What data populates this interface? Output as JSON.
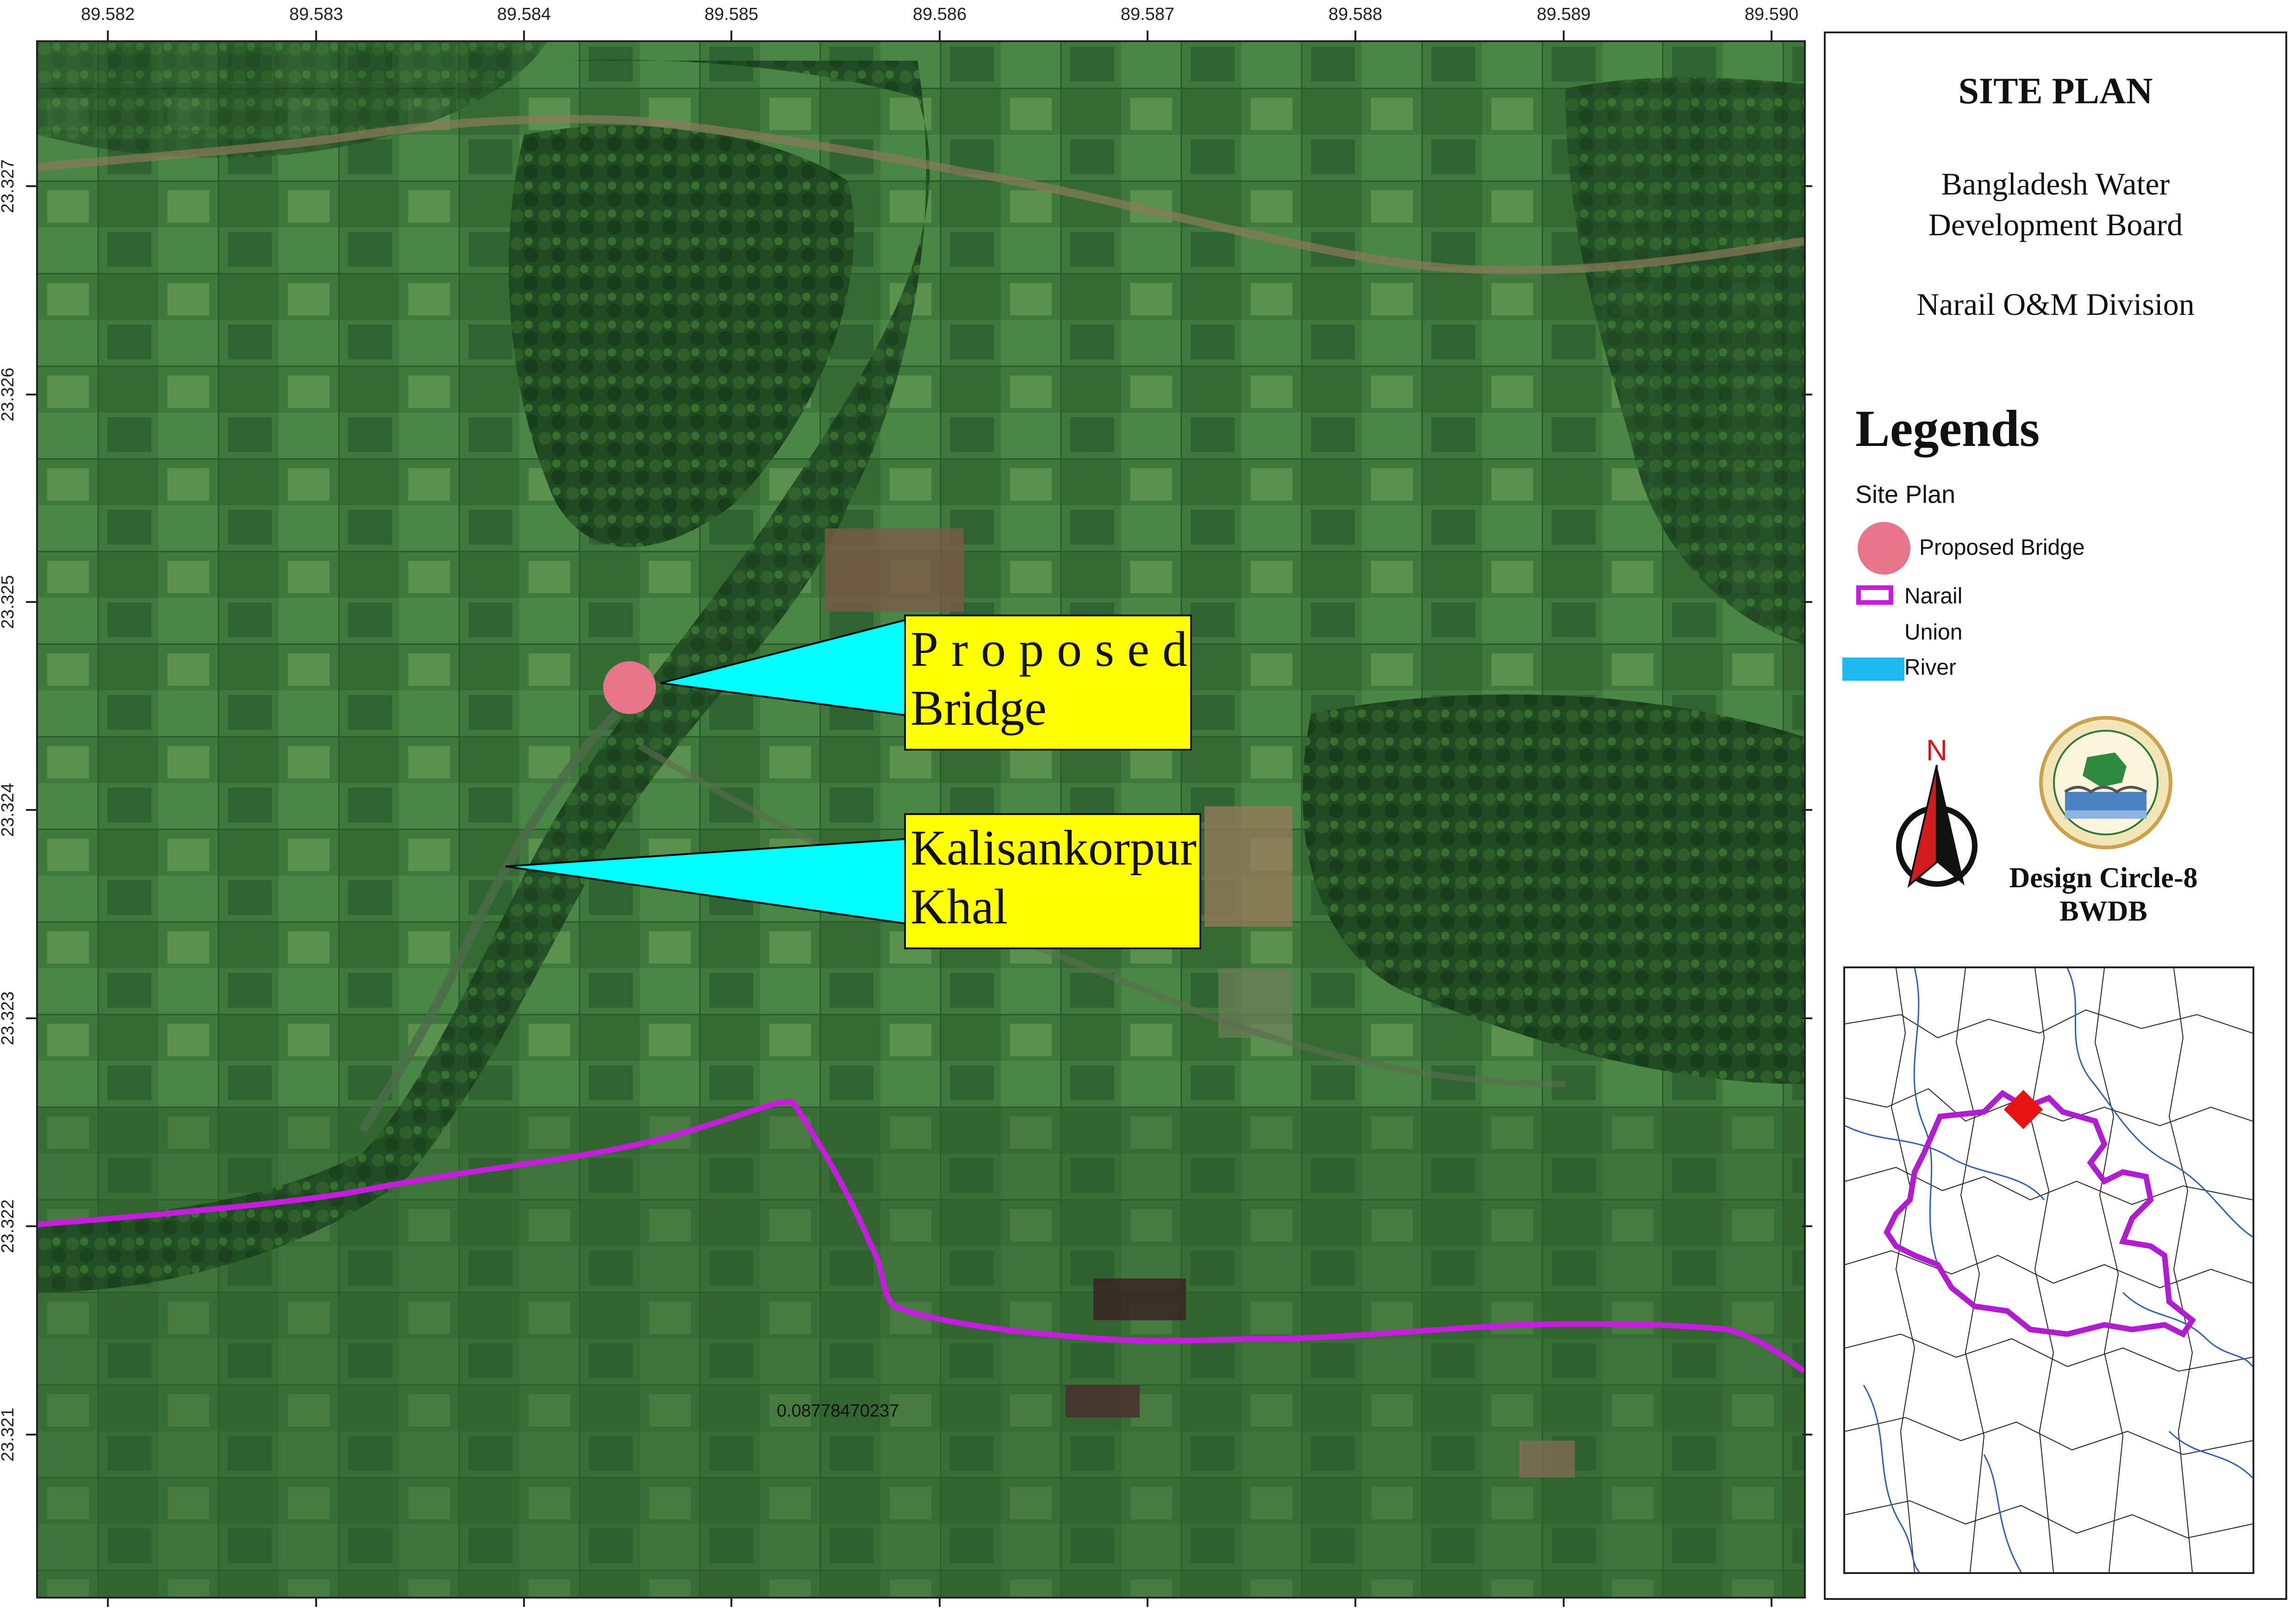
{
  "axes": {
    "longitude_labels": [
      "89.582",
      "89.583",
      "89.584",
      "89.585",
      "89.586",
      "89.587",
      "89.588",
      "89.589",
      "89.590"
    ],
    "latitude_labels": [
      "23.327",
      "23.326",
      "23.325",
      "23.324",
      "23.323",
      "23.322",
      "23.321"
    ]
  },
  "map": {
    "callouts": [
      {
        "line1": "Proposed",
        "line2": "Bridge"
      },
      {
        "line1": "Kalisankorpur",
        "line2": "Khal"
      }
    ],
    "scale_label": "0.08778470237",
    "colors": {
      "boundary": "#c71ce0",
      "bridge": "#e8768a",
      "callout_arrow": "#00ffff",
      "callout_box": "#ffff00"
    }
  },
  "panel": {
    "title": "SITE PLAN",
    "org_line1": "Bangladesh Water",
    "org_line2": "Development Board",
    "division": "Narail O&M Division",
    "legend_title": "Legends",
    "legend_subtitle": "Site Plan",
    "legend_items": [
      {
        "label": "Proposed Bridge",
        "icon": "pink-circle-icon"
      },
      {
        "label": "Narail",
        "icon": "purple-outline-rect-icon"
      },
      {
        "label": "Union",
        "icon": "none"
      },
      {
        "label": "River",
        "icon": "cyan-rect-icon"
      }
    ],
    "north_letter": "N",
    "design_line1": "Design Circle-8",
    "design_line2": "BWDB"
  }
}
